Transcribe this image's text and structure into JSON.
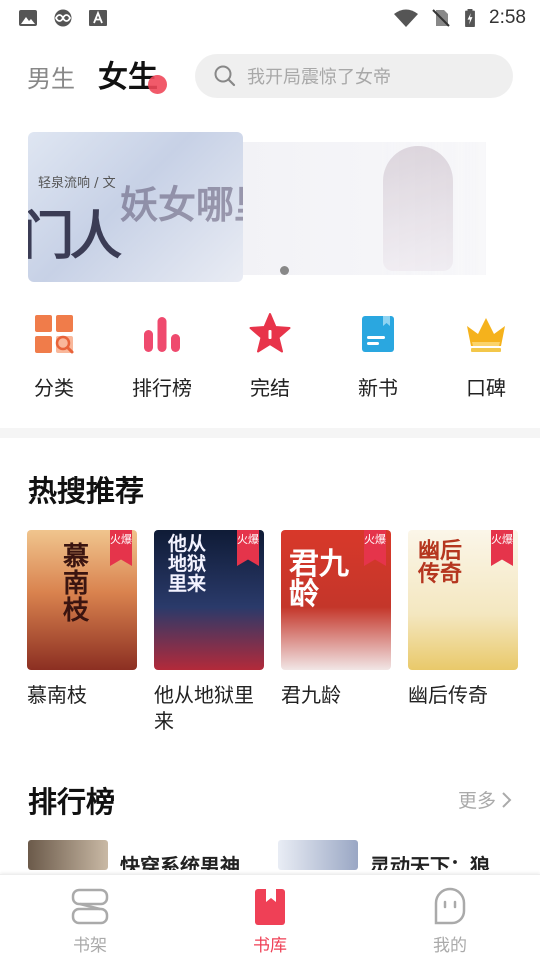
{
  "status_bar": {
    "time": "2:58",
    "left_icons": [
      "image-icon",
      "infinity-icon",
      "font-download-icon"
    ],
    "right_icons": [
      "wifi-icon",
      "no-sim-icon",
      "battery-charging-icon"
    ]
  },
  "header": {
    "tabs": [
      {
        "label": "男生",
        "active": false
      },
      {
        "label": "女生",
        "active": true
      }
    ],
    "search": {
      "placeholder": "我开局震惊了女帝",
      "icon": "search-icon"
    }
  },
  "banner": {
    "author_text": "轻泉流响 / 文",
    "main_title": "门人",
    "overlay_title": "妖女哪里逃",
    "page_indicator": {
      "count": 1,
      "active": 0
    }
  },
  "quick_nav": [
    {
      "label": "分类",
      "icon": "category-icon",
      "color": "#f07c4a"
    },
    {
      "label": "排行榜",
      "icon": "bar-chart-icon",
      "color": "#ef4a6e"
    },
    {
      "label": "完结",
      "icon": "star-icon",
      "color": "#e8344a"
    },
    {
      "label": "新书",
      "icon": "new-book-icon",
      "color": "#2aa7e0"
    },
    {
      "label": "口碑",
      "icon": "crown-icon",
      "color": "#f5b21c"
    }
  ],
  "hot_search": {
    "title": "热搜推荐",
    "badge": "火爆",
    "books": [
      {
        "title": "慕南枝",
        "cover_text": "慕南枝",
        "cover_color": "#b84a2e"
      },
      {
        "title": "他从地狱里来",
        "cover_text": "他从地狱里来",
        "cover_color": "#1c2a4a"
      },
      {
        "title": "君九龄",
        "cover_text": "君九龄",
        "cover_color": "#d23a2c"
      },
      {
        "title": "幽后传奇",
        "cover_text": "幽后传奇",
        "cover_color": "#f3ead6"
      }
    ]
  },
  "rank": {
    "title": "排行榜",
    "more_label": "更多",
    "items": [
      {
        "name": "快穿系统男神"
      },
      {
        "name": "灵动天下：狼"
      }
    ]
  },
  "bottom_nav": [
    {
      "label": "书架",
      "icon": "bookshelf-icon",
      "active": false
    },
    {
      "label": "书库",
      "icon": "library-icon",
      "active": true
    },
    {
      "label": "我的",
      "icon": "profile-icon",
      "active": false
    }
  ],
  "colors": {
    "accent": "#ef4056",
    "search_bg": "#efefef",
    "muted": "#aaaaaa"
  }
}
